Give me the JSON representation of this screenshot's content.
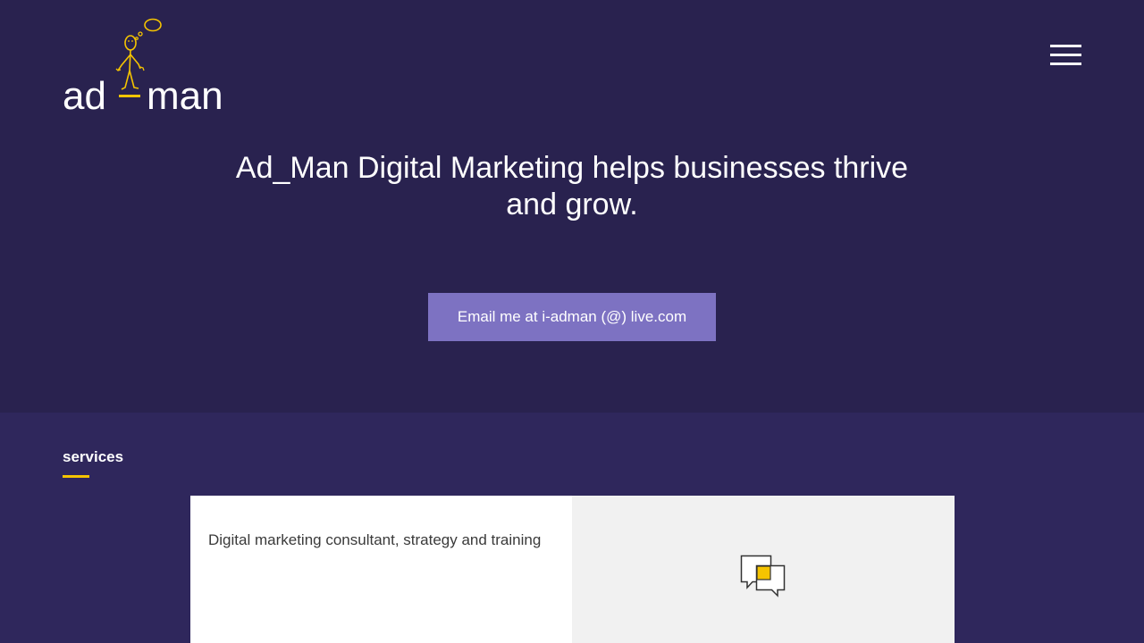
{
  "header": {
    "logo": {
      "word_left": "ad",
      "word_right": "man"
    },
    "menu_icon": "hamburger-menu-icon"
  },
  "hero": {
    "headline": "Ad_Man Digital Marketing helps businesses thrive and grow.",
    "cta_label": "Email me at i-adman (@) live.com"
  },
  "services": {
    "heading": "services",
    "cards": [
      {
        "title": "Digital marketing consultant, strategy and training",
        "icon": "chat-bubbles-icon"
      }
    ]
  },
  "colors": {
    "hero_background": "#29224f",
    "services_background": "#2f275c",
    "button": "#7d72c2",
    "accent_yellow": "#f5c400",
    "card_light": "#ffffff",
    "card_grey": "#f1f1f1"
  }
}
